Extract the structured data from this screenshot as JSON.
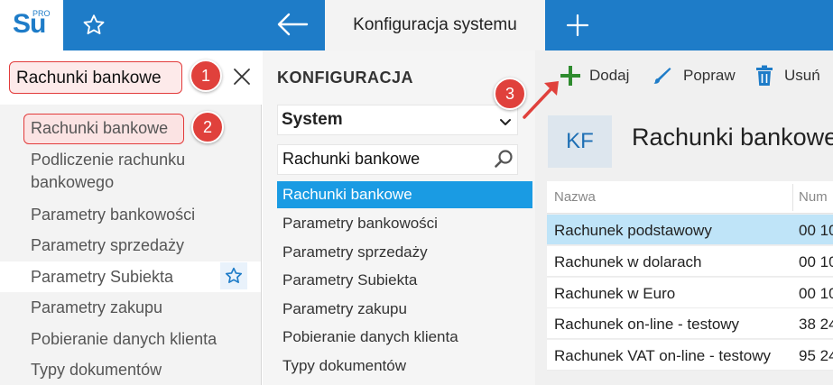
{
  "app": {
    "logo_text": "Su",
    "logo_sup": "PRO"
  },
  "topbar": {
    "tab_title": "Konfiguracja systemu"
  },
  "left": {
    "search_value": "Rachunki bankowe",
    "items": [
      "Rachunki bankowe",
      "Podliczenie rachunku",
      "bankowego",
      "Parametry bankowości",
      "Parametry sprzedaży",
      "Parametry Subiekta",
      "Parametry zakupu",
      "Pobieranie danych klienta",
      "Typy dokumentów"
    ]
  },
  "annotations": {
    "b1": "1",
    "b2": "2",
    "b3": "3"
  },
  "middle": {
    "header": "KONFIGURACJA",
    "select_value": "System",
    "search_value": "Rachunki bankowe",
    "items": [
      "Rachunki bankowe",
      "Parametry bankowości",
      "Parametry sprzedaży",
      "Parametry Subiekta",
      "Parametry zakupu",
      "Pobieranie danych klienta",
      "Typy dokumentów"
    ]
  },
  "toolbar": {
    "add": "Dodaj",
    "edit": "Popraw",
    "delete": "Usuń"
  },
  "entity": {
    "badge": "KF",
    "title": "Rachunki bankowe"
  },
  "grid": {
    "headers": [
      "Nazwa",
      "Num"
    ],
    "rows": [
      {
        "name": "Rachunek podstawowy",
        "num": "00 10"
      },
      {
        "name": "Rachunek w dolarach",
        "num": "00 10"
      },
      {
        "name": "Rachunek w Euro",
        "num": "00 10"
      },
      {
        "name": "Rachunek on-line - testowy",
        "num": "38 24"
      },
      {
        "name": "Rachunek VAT on-line - testowy",
        "num": "95 24"
      }
    ]
  },
  "colors": {
    "brand_blue": "#1e7cc8",
    "selected_blue": "#1a9be3",
    "annotation_red": "#e0413c",
    "add_green": "#2e8b2e"
  }
}
